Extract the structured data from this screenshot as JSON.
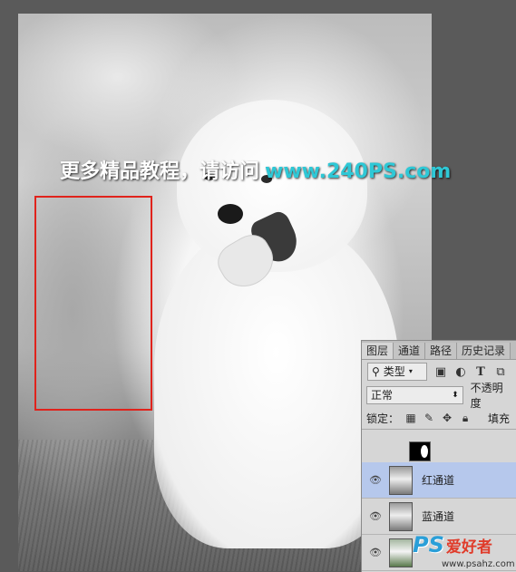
{
  "watermark": {
    "chinese": "更多精品教程，请访问",
    "url": "www.240PS.com"
  },
  "panel": {
    "tabs": [
      "图层",
      "通道",
      "路径",
      "历史记录"
    ],
    "filter_kind": "类型",
    "filter_icons": [
      "image-filter-icon",
      "adjustment-filter-icon",
      "text-filter-icon",
      "shape-filter-icon"
    ],
    "filter_text_glyph": "T",
    "blend_mode": "正常",
    "opacity_label": "不透明度",
    "lock_label": "锁定：",
    "fill_label": "填充",
    "layers": [
      {
        "name": "红通道",
        "selected": true
      },
      {
        "name": "蓝通道",
        "selected": false
      }
    ]
  },
  "logo": {
    "ps": "PS",
    "cn": "爱好者",
    "url": "www.psahz.com"
  },
  "colors": {
    "selection": "#e0231c",
    "watermark_url": "#2ec8d6",
    "layer_selected": "#b6c8ec"
  }
}
